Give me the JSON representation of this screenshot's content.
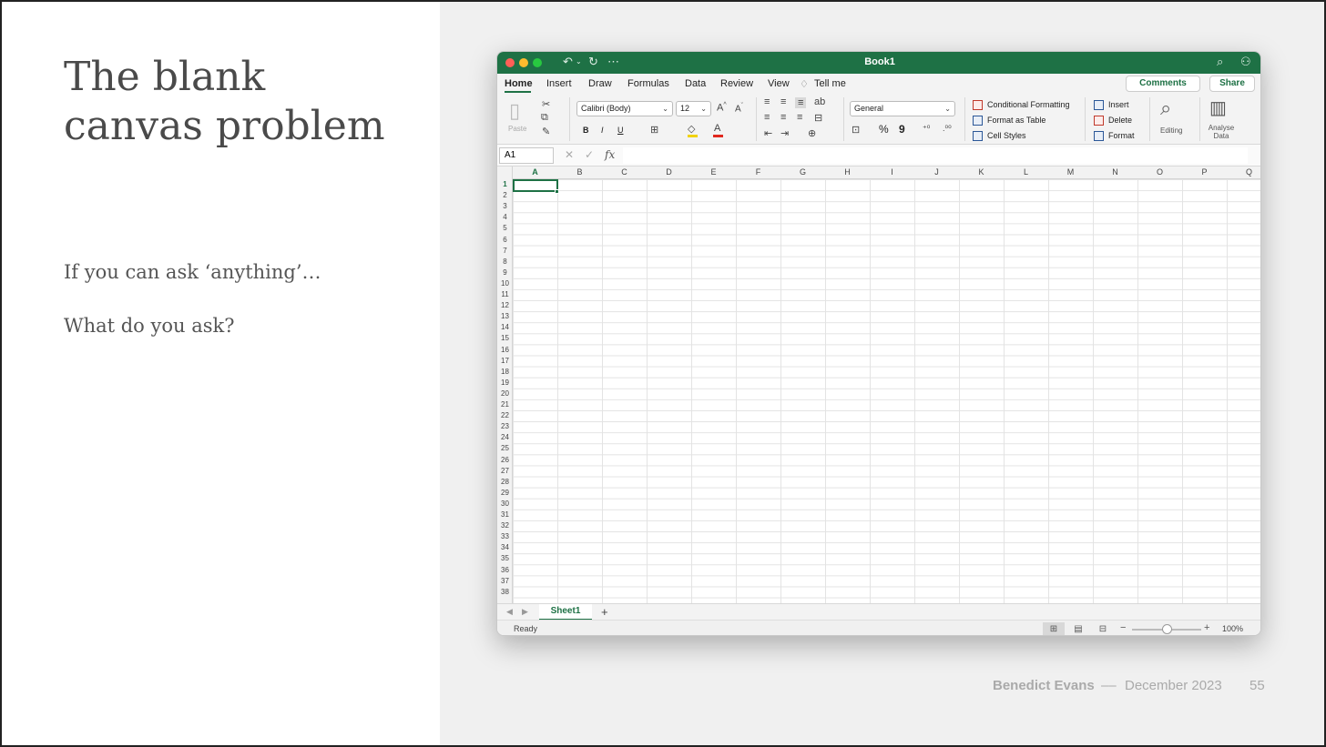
{
  "slide": {
    "title_line1": "The blank",
    "title_line2": "canvas problem",
    "text1": "If you can ask ‘anything’…",
    "text2": "What do you ask?",
    "footer": {
      "author": "Benedict Evans",
      "separator": "––",
      "date": "December 2023",
      "page": "55"
    }
  },
  "excel": {
    "window_title": "Book1",
    "tabs": [
      "Home",
      "Insert",
      "Draw",
      "Formulas",
      "Data",
      "Review",
      "View",
      "Tell me"
    ],
    "comments_label": "Comments",
    "share_label": "Share",
    "ribbon": {
      "paste": "Paste",
      "font_name": "Calibri (Body)",
      "font_size": "12",
      "bold": "B",
      "italic": "I",
      "underline": "U",
      "number_format": "General",
      "percent": "%",
      "comma": "9",
      "conditional_formatting": "Conditional Formatting",
      "format_as_table": "Format as Table",
      "cell_styles": "Cell Styles",
      "insert": "Insert",
      "delete": "Delete",
      "format": "Format",
      "editing": "Editing",
      "analyse_line1": "Analyse",
      "analyse_line2": "Data"
    },
    "name_box": "A1",
    "fx_label": "fx",
    "columns": [
      "A",
      "B",
      "C",
      "D",
      "E",
      "F",
      "G",
      "H",
      "I",
      "J",
      "K",
      "L",
      "M",
      "N",
      "O",
      "P",
      "Q"
    ],
    "rows": [
      "1",
      "2",
      "3",
      "4",
      "5",
      "6",
      "7",
      "8",
      "9",
      "10",
      "11",
      "12",
      "13",
      "14",
      "15",
      "16",
      "17",
      "18",
      "19",
      "20",
      "21",
      "22",
      "23",
      "24",
      "25",
      "26",
      "27",
      "28",
      "29",
      "30",
      "31",
      "32",
      "33",
      "34",
      "35",
      "36",
      "37",
      "38"
    ],
    "sheet_tab": "Sheet1",
    "add_sheet": "+",
    "status": "Ready",
    "zoom": "100%",
    "colors": {
      "brand": "#1e7145"
    }
  }
}
